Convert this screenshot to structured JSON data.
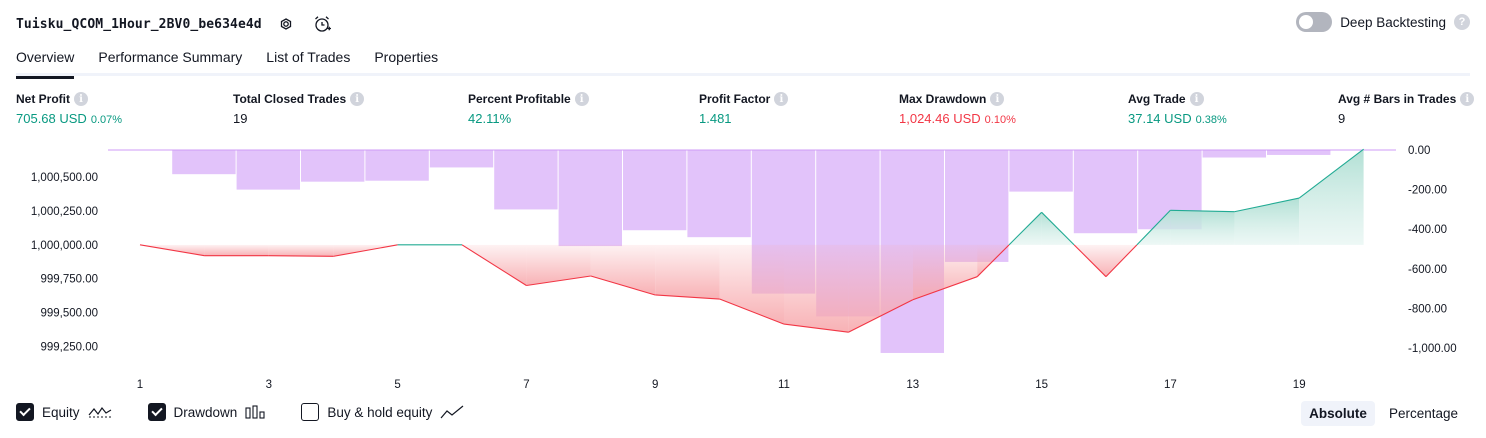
{
  "header": {
    "strategy_title": "Tuisku_QCOM_1Hour_2BV0_be634e4d",
    "deep_backtesting_label": "Deep Backtesting",
    "help_glyph": "?"
  },
  "tabs": [
    {
      "label": "Overview",
      "active": true
    },
    {
      "label": "Performance Summary",
      "active": false
    },
    {
      "label": "List of Trades",
      "active": false
    },
    {
      "label": "Properties",
      "active": false
    }
  ],
  "metrics": [
    {
      "label": "Net Profit",
      "value": "705.68 USD",
      "pct": "0.07%",
      "color": "green"
    },
    {
      "label": "Total Closed Trades",
      "value": "19",
      "pct": "",
      "color": "dark"
    },
    {
      "label": "Percent Profitable",
      "value": "42.11%",
      "pct": "",
      "color": "green"
    },
    {
      "label": "Profit Factor",
      "value": "1.481",
      "pct": "",
      "color": "green"
    },
    {
      "label": "Max Drawdown",
      "value": "1,024.46 USD",
      "pct": "0.10%",
      "color": "red"
    },
    {
      "label": "Avg Trade",
      "value": "37.14 USD",
      "pct": "0.38%",
      "color": "green"
    },
    {
      "label": "Avg # Bars in Trades",
      "value": "9",
      "pct": "",
      "color": "dark"
    }
  ],
  "info_glyph": "i",
  "chart_data": {
    "type": "line",
    "x_ticks": [
      "1",
      "3",
      "5",
      "7",
      "9",
      "11",
      "13",
      "15",
      "17",
      "19"
    ],
    "equity": {
      "x": [
        1,
        2,
        3,
        4,
        5,
        6,
        7,
        8,
        9,
        10,
        11,
        12,
        13,
        14,
        15,
        16,
        17,
        18,
        19,
        20
      ],
      "values": [
        1000000,
        999920,
        999920,
        999915,
        1000000,
        1000000,
        999700,
        999770,
        999630,
        999600,
        999415,
        999355,
        999595,
        999765,
        1000240,
        999765,
        1000255,
        1000245,
        1000345,
        1000705.68
      ],
      "baseline": 1000000,
      "ylim": [
        999150,
        1000700
      ],
      "y_ticks": [
        "1,000,500.00",
        "1,000,250.00",
        "1,000,000.00",
        "999,750.00",
        "999,500.00",
        "999,250.00"
      ],
      "y_tick_values": [
        1000500,
        1000250,
        1000000,
        999750,
        999500,
        999250
      ],
      "colors": {
        "up_line": "#22ab94",
        "down_line": "#f23645",
        "up_fill": "#e1f3ef",
        "down_fill": "#f7a9ad"
      }
    },
    "drawdown": {
      "x": [
        1,
        2,
        3,
        4,
        5,
        6,
        7,
        8,
        9,
        10,
        11,
        12,
        13,
        14,
        15,
        16,
        17,
        18,
        19,
        20
      ],
      "values": [
        0,
        -122,
        -200,
        -160,
        -155,
        -88,
        -300,
        -485,
        -405,
        -440,
        -725,
        -840,
        -1024.46,
        -565,
        -210,
        -420,
        -400,
        -38,
        -25,
        0
      ],
      "ylim": [
        -1060,
        0
      ],
      "y_ticks": [
        "0.00",
        "-200.00",
        "-400.00",
        "-600.00",
        "-800.00",
        "-1,000.00"
      ],
      "y_tick_values": [
        0,
        -200,
        -400,
        -600,
        -800,
        -1000
      ],
      "color": "#cf9bf7"
    }
  },
  "legend": {
    "equity_label": "Equity",
    "drawdown_label": "Drawdown",
    "buyhold_label": "Buy & hold equity"
  },
  "mode": {
    "absolute_label": "Absolute",
    "percentage_label": "Percentage"
  }
}
